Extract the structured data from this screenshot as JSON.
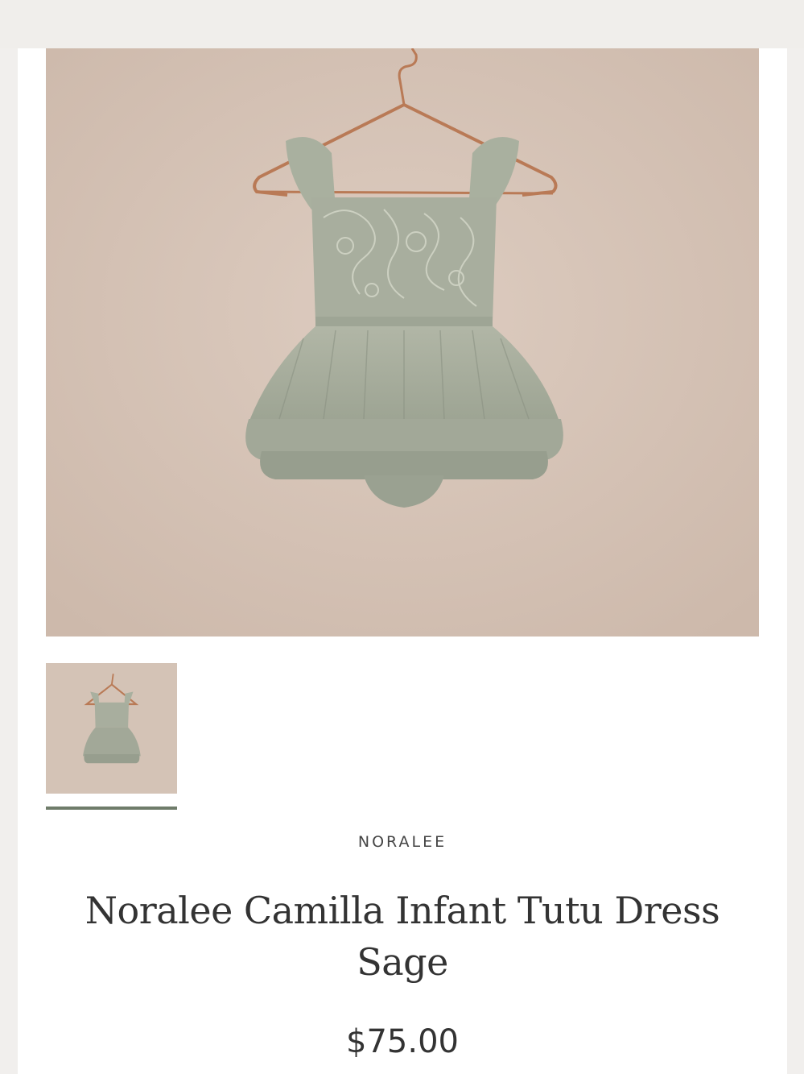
{
  "product": {
    "vendor": "NORALEE",
    "title": "Noralee Camilla Infant Tutu Dress Sage",
    "price": "$75.00"
  },
  "gallery": {
    "main_image_description": "sage lace tutu dress on copper hanger",
    "thumbnails": [
      {
        "selected": true
      }
    ]
  },
  "colors": {
    "background_image": "#d7c5b9",
    "dress": "#a9b09f",
    "hanger": "#b97a56",
    "indicator": "#6f7c6a"
  }
}
